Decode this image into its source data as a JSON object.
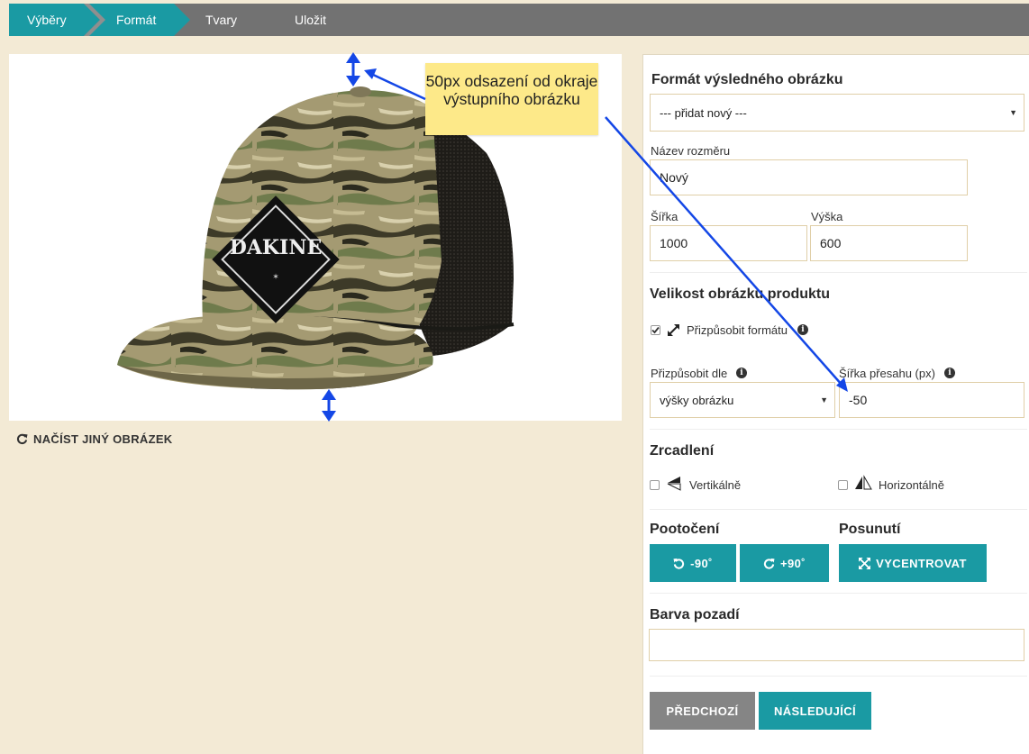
{
  "breadcrumb": {
    "steps": [
      "Výběry",
      "Formát",
      "Tvary",
      "Uložit"
    ],
    "active_index": 1
  },
  "preview": {
    "reload_label": "NAČÍST JINÝ OBRÁZEK",
    "reload_icon": "refresh-icon",
    "cap_text": "DAKINE"
  },
  "callout": {
    "text": "50px odsazení od okraje výstupního obrázku"
  },
  "panel": {
    "format_heading": "Formát výsledného obrázku",
    "format_select": {
      "value": "--- přidat nový ---"
    },
    "size_name": {
      "label": "Název rozměru",
      "value": "Nový"
    },
    "width": {
      "label": "Šířka",
      "value": "1000"
    },
    "height": {
      "label": "Výška",
      "value": "600"
    },
    "product_size_heading": "Velikost obrázku produktu",
    "fit_format": {
      "label": "Přizpůsobit formátu",
      "checked": true,
      "icon": "resize-arrows-icon"
    },
    "fit_by": {
      "label": "Přizpůsobit dle",
      "value": "výšky obrázku"
    },
    "overflow_width": {
      "label": "Šířka přesahu (px)",
      "value": "-50"
    },
    "mirror_heading": "Zrcadlení",
    "mirror_vertical": {
      "label": "Vertikálně",
      "checked": false,
      "icon": "flip-vertical-icon"
    },
    "mirror_horizontal": {
      "label": "Horizontálně",
      "checked": false,
      "icon": "flip-horizontal-icon"
    },
    "rotation_heading": "Pootočení",
    "rotate_left": {
      "label": "-90˚",
      "icon": "rotate-left-icon"
    },
    "rotate_right": {
      "label": "+90˚",
      "icon": "rotate-right-icon"
    },
    "shift_heading": "Posunutí",
    "center_button": {
      "label": "VYCENTROVAT",
      "icon": "center-arrows-icon"
    },
    "bg_color_heading": "Barva pozadí",
    "bg_color": {
      "value": ""
    },
    "prev_button": "PŘEDCHOZÍ",
    "next_button": "NÁSLEDUJÍCÍ"
  },
  "colors": {
    "accent": "#1a9aa3",
    "background": "#f3ead5",
    "breadcrumb_bar": "#727272",
    "callout": "#fde989",
    "annotation": "#1447e6",
    "grey_button": "#858585"
  }
}
